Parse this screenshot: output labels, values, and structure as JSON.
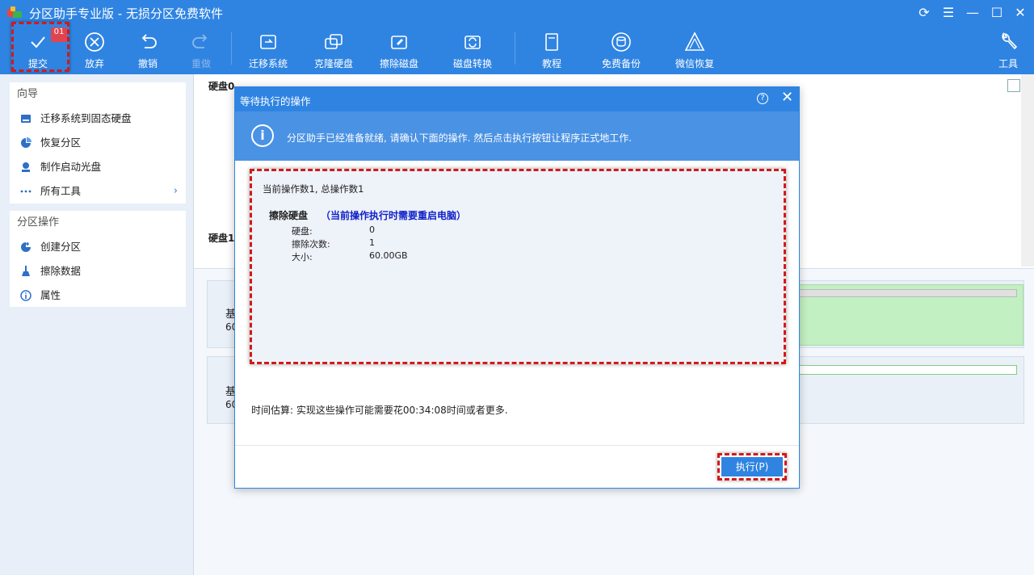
{
  "app": {
    "title": "分区助手专业版 - 无损分区免费软件"
  },
  "window_controls": [
    "refresh-icon",
    "menu-icon",
    "minimize-icon",
    "maximize-icon",
    "close-icon"
  ],
  "toolbar": {
    "submit": "提交",
    "submit_badge": "01",
    "discard": "放弃",
    "undo": "撤销",
    "redo": "重做",
    "migrate": "迁移系统",
    "clone": "克隆硬盘",
    "wipe": "擦除磁盘",
    "convert": "磁盘转换",
    "tutorial": "教程",
    "backup": "免费备份",
    "wechat": "微信恢复",
    "tools": "工具"
  },
  "sidebar": {
    "wizard": {
      "title": "向导",
      "items": [
        {
          "label": "迁移系统到固态硬盘",
          "icon": "ssd-icon"
        },
        {
          "label": "恢复分区",
          "icon": "pie-restore-icon"
        },
        {
          "label": "制作启动光盘",
          "icon": "boot-disk-icon"
        },
        {
          "label": "所有工具",
          "icon": "more-dots-icon"
        }
      ]
    },
    "partition_ops": {
      "title": "分区操作",
      "items": [
        {
          "label": "创建分区",
          "icon": "create-partition-icon"
        },
        {
          "label": "擦除数据",
          "icon": "broom-icon"
        },
        {
          "label": "属性",
          "icon": "info-icon"
        }
      ]
    }
  },
  "main": {
    "disk0_label": "硬盘0",
    "disk1_label": "硬盘1",
    "card1_line1": "基",
    "card1_line2": "60",
    "card2_line1": "基",
    "card2_line2": "60"
  },
  "dialog": {
    "title": "等待执行的操作",
    "info_text": "分区助手已经准备就绪, 请确认下面的操作. 然后点击执行按钮让程序正式地工作.",
    "summary": "当前操作数1, 总操作数1",
    "operation": {
      "name": "擦除硬盘",
      "note": "（当前操作执行时需要重启电脑）",
      "rows": [
        {
          "label": "硬盘:",
          "value": "0"
        },
        {
          "label": "擦除次数:",
          "value": "1"
        },
        {
          "label": "大小:",
          "value": "60.00GB"
        }
      ]
    },
    "time_estimate": "时间估算: 实现这些操作可能需要花00:34:08时间或者更多.",
    "execute_button": "执行(P)"
  },
  "colors": {
    "brand_blue": "#2f84e2",
    "highlight_red": "#d11a1a",
    "note_blue": "#1021c8",
    "partition_green": "#c2f0c2"
  }
}
